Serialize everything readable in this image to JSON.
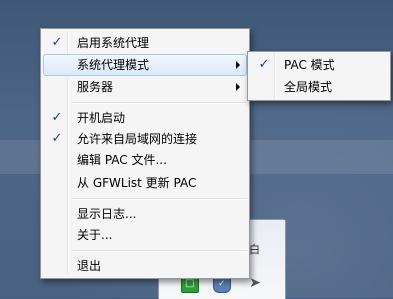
{
  "main_menu": {
    "items": [
      {
        "label": "启用系统代理",
        "checked": true,
        "submenu": false
      },
      {
        "label": "系统代理模式",
        "checked": false,
        "submenu": true,
        "highlighted": true
      },
      {
        "label": "服务器",
        "checked": false,
        "submenu": true
      },
      {
        "label": "开机启动",
        "checked": true,
        "submenu": false
      },
      {
        "label": "允许来自局域网的连接",
        "checked": true,
        "submenu": false
      },
      {
        "label": "编辑 PAC 文件...",
        "checked": false,
        "submenu": false
      },
      {
        "label": "从 GFWList 更新 PAC",
        "checked": false,
        "submenu": false
      },
      {
        "label": "显示日志...",
        "checked": false,
        "submenu": false
      },
      {
        "label": "关于...",
        "checked": false,
        "submenu": false
      },
      {
        "label": "退出",
        "checked": false,
        "submenu": false
      }
    ]
  },
  "sub_menu": {
    "items": [
      {
        "label": "PAC 模式",
        "checked": true
      },
      {
        "label": "全局模式",
        "checked": false
      }
    ]
  },
  "check_glyph": "✓",
  "tray": {
    "icons": [
      "green-app-icon",
      "shield-icon",
      "paper-plane-icon"
    ],
    "green_glyph": "□",
    "shield_glyph": "✓",
    "plane_glyph": "➤",
    "partial_glyph": "白"
  },
  "colors": {
    "highlight_border": "#a8c8f0",
    "check": "#1c3a8a",
    "desktop": "#465f80"
  }
}
